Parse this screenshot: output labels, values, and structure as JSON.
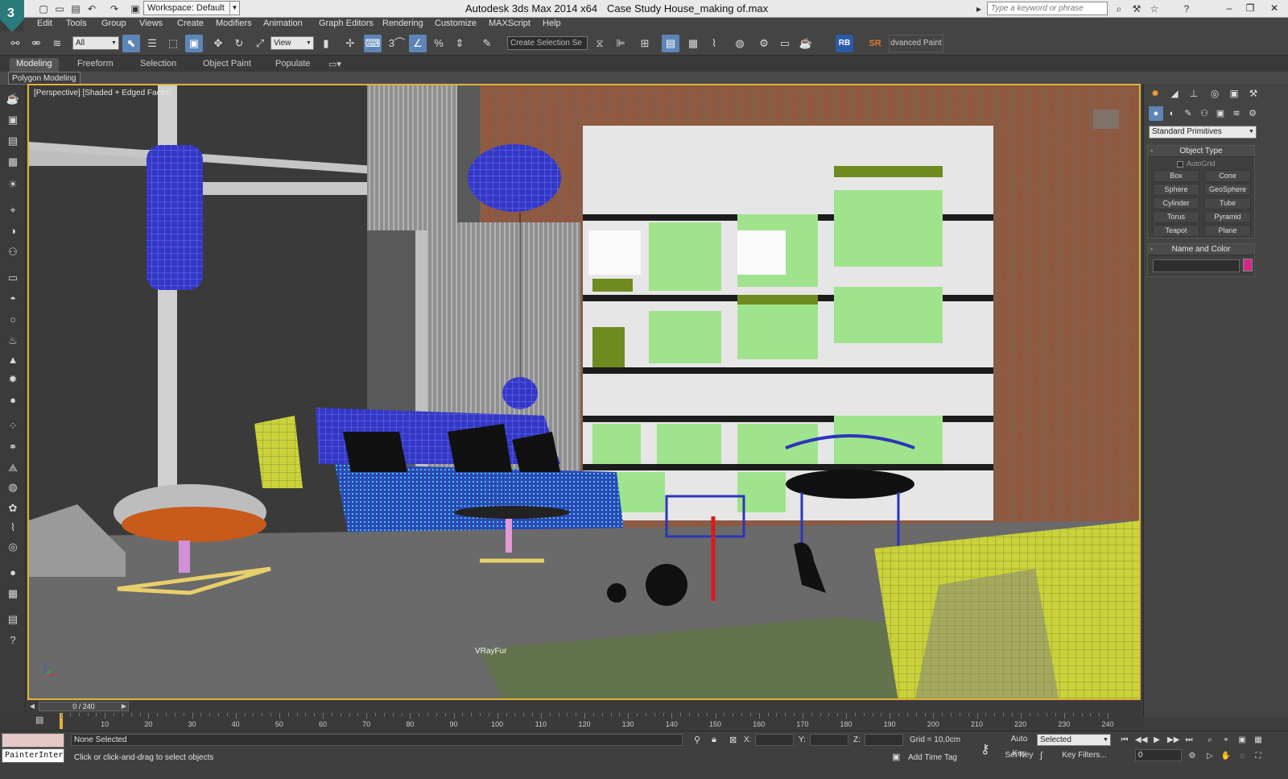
{
  "titlebar": {
    "app_logo_letter": "3",
    "workspace": "Workspace: Default",
    "app_title": "Autodesk 3ds Max  2014 x64",
    "file_title": "Case Study House_making of.max",
    "search_placeholder": "Type a keyword or phrase"
  },
  "menu": [
    "Edit",
    "Tools",
    "Group",
    "Views",
    "Create",
    "Modifiers",
    "Animation",
    "Graph Editors",
    "Rendering",
    "Customize",
    "MAXScript",
    "Help"
  ],
  "toolbar": {
    "selection_filter": "All",
    "ref_coord": "View",
    "snap_label": "3",
    "named_selection": "Create Selection Se",
    "rb_label": "RB",
    "sr_label": "SR",
    "adv_paint": "dvanced Paint"
  },
  "ribbon": {
    "tabs": [
      "Modeling",
      "Freeform",
      "Selection",
      "Object Paint",
      "Populate"
    ],
    "active_tab": "Modeling",
    "panel_label": "Polygon Modeling"
  },
  "viewport": {
    "label": "[ +] [ Perspective ] [ Shaded + Edged Faces ]",
    "label_visible": "[Perspective] [Shaded + Edged Faces]",
    "vrayfur_label": "VRayFur"
  },
  "command_panel": {
    "category": "Standard Primitives",
    "object_type_title": "Object Type",
    "autogrid": "AutoGrid",
    "object_buttons": [
      "Box",
      "Cone",
      "Sphere",
      "GeoSphere",
      "Cylinder",
      "Tube",
      "Torus",
      "Pyramid",
      "Teapot",
      "Plane"
    ],
    "name_color_title": "Name and Color",
    "swatch_color": "#d12a86"
  },
  "timeline": {
    "frame_display": "0 / 240",
    "ticks": [
      "10",
      "20",
      "30",
      "40",
      "50",
      "60",
      "70",
      "80",
      "90",
      "100",
      "110",
      "120",
      "130",
      "140",
      "150",
      "160",
      "170",
      "180",
      "190",
      "200",
      "210",
      "220",
      "230",
      "240"
    ]
  },
  "status": {
    "listener_text": "PainterInter",
    "selection_status": "None Selected",
    "prompt": "Click or click-and-drag to select objects",
    "x_label": "X:",
    "y_label": "Y:",
    "z_label": "Z:",
    "grid": "Grid = 10,0cm",
    "add_time_tag": "Add Time Tag",
    "auto_key": "Auto Key",
    "set_key": "Set Key",
    "key_mode": "Selected",
    "key_filters": "Key Filters...",
    "current_frame": "0"
  }
}
